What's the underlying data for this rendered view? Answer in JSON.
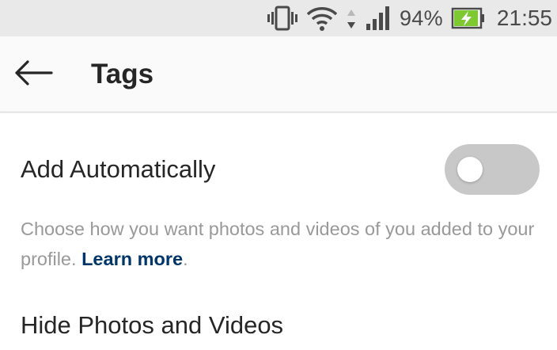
{
  "status_bar": {
    "battery_percent": "94%",
    "battery_level": 0.94,
    "time": "21:55",
    "icons": [
      "vibrate-icon",
      "wifi-icon",
      "data-arrows-icon",
      "signal-icon",
      "battery-charging-icon"
    ]
  },
  "app_bar": {
    "title": "Tags",
    "back_icon": "arrow-left-icon"
  },
  "settings": {
    "add_automatically": {
      "label": "Add Automatically",
      "enabled": false
    },
    "description": {
      "text": "Choose how you want photos and videos of you added to your profile. ",
      "link_text": "Learn more",
      "trailing": "."
    },
    "hide_photos": {
      "label": "Hide Photos and Videos"
    }
  },
  "colors": {
    "status_bar_bg": "#e9e9e9",
    "app_bar_bg": "#fafafa",
    "toggle_off_track": "#c8c8c8",
    "link": "#003569",
    "battery_fill": "#7ec832",
    "text_primary": "#262626",
    "text_secondary": "#999999"
  }
}
